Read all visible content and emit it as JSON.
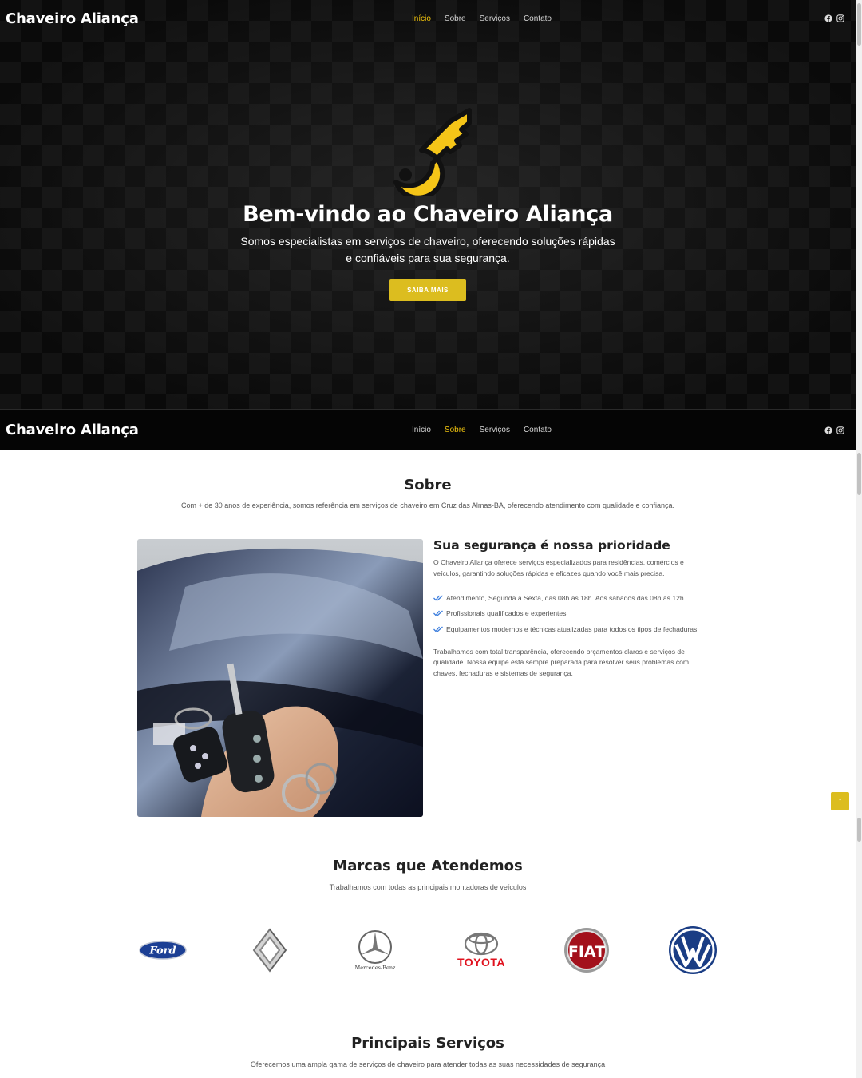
{
  "brand": "Chaveiro Aliança",
  "nav": {
    "items": [
      "Início",
      "Sobre",
      "Serviços",
      "Contato"
    ],
    "top_active": "Início",
    "sticky_active": "Sobre"
  },
  "social": [
    "facebook-icon",
    "instagram-icon"
  ],
  "colors": {
    "accent": "#dcbd1f",
    "nav_active": "#f1c40f",
    "dark": "#0f0f0f"
  },
  "hero": {
    "title": "Bem-vindo ao Chaveiro Aliança",
    "subtitle": "Somos especialistas em serviços de chaveiro, oferecendo soluções rápidas e confiáveis para sua segurança.",
    "button": "SAIBA MAIS"
  },
  "about": {
    "title": "Sobre",
    "subtitle": "Com + de 30 anos de experiência, somos referência em serviços de chaveiro em Cruz das Almas-BA, oferecendo atendimento com qualidade e confiança.",
    "heading": "Sua segurança é nossa prioridade",
    "intro": "O Chaveiro Aliança oferece serviços especializados para residências, comércios e veículos, garantindo soluções rápidas e eficazes quando você mais precisa.",
    "checks": [
      "Atendimento, Segunda a Sexta, das 08h ás 18h. Aos sábados das 08h ás 12h.",
      "Profissionais qualificados e experientes",
      "Equipamentos modernos e técnicas atualizadas para todos os tipos de fechaduras"
    ],
    "outro": "Trabalhamos com total transparência, oferecendo orçamentos claros e serviços de qualidade. Nossa equipe está sempre preparada para resolver seus problemas com chaves, fechaduras e sistemas de segurança."
  },
  "brands": {
    "title": "Marcas que Atendemos",
    "subtitle": "Trabalhamos com todas as principais montadoras de veículos",
    "logos": [
      "Ford",
      "Renault",
      "Mercedes-Benz",
      "TOYOTA",
      "FIAT",
      "VW"
    ]
  },
  "services": {
    "title": "Principais Serviços",
    "subtitle": "Oferecemos uma ampla gama de serviços de chaveiro para atender todas as suas necessidades de segurança"
  },
  "to_top": "↑"
}
